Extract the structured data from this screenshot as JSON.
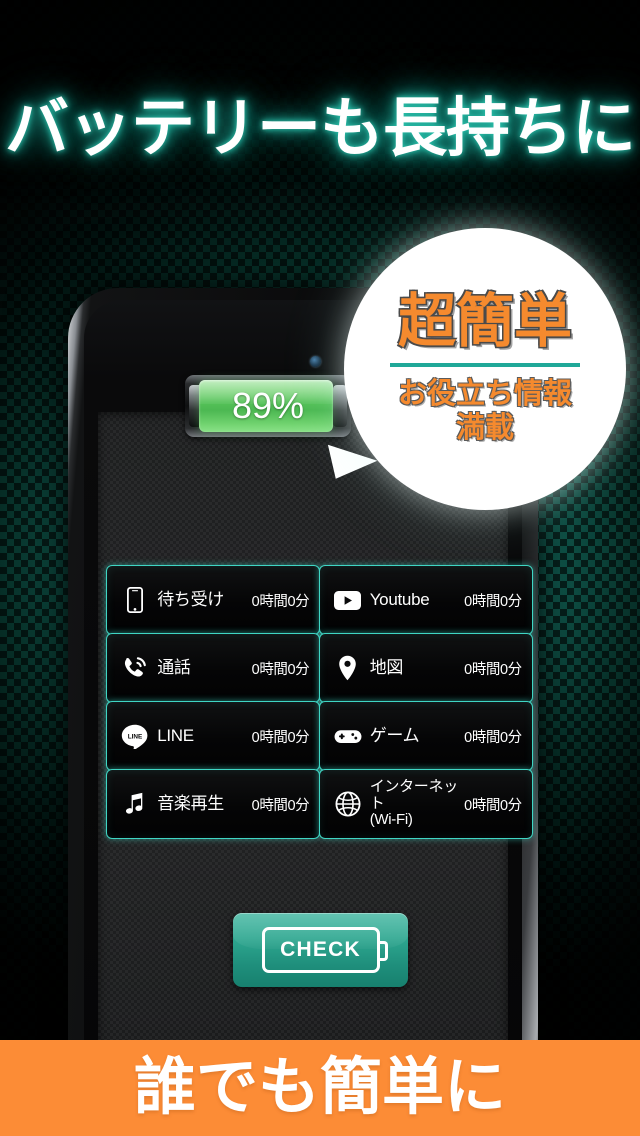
{
  "headline": {
    "text": "バッテリーも長持ちに",
    "glow_color": "#1fa898",
    "text_color": "#ffffff"
  },
  "badge": {
    "main_text": "超簡単",
    "sub_line1": "お役立ち情報",
    "sub_line2": "満載",
    "text_color": "#f58a2e",
    "rule_color": "#1fa898",
    "background_color": "#ffffff"
  },
  "battery": {
    "percent_label": "89%",
    "percent_value": 89,
    "fill_color": "#55c258"
  },
  "usage_grid": {
    "rows": [
      {
        "left": {
          "icon": "smartphone-icon",
          "label": "待ち受け",
          "time": "0時間0分"
        },
        "right": {
          "icon": "youtube-icon",
          "label": "Youtube",
          "time": "0時間0分"
        }
      },
      {
        "left": {
          "icon": "phone-call-icon",
          "label": "通話",
          "time": "0時間0分"
        },
        "right": {
          "icon": "map-pin-icon",
          "label": "地図",
          "time": "0時間0分"
        }
      },
      {
        "left": {
          "icon": "line-logo-icon",
          "label": "LINE",
          "time": "0時間0分"
        },
        "right": {
          "icon": "gamepad-icon",
          "label": "ゲーム",
          "time": "0時間0分"
        }
      },
      {
        "left": {
          "icon": "music-note-icon",
          "label": "音楽再生",
          "time": "0時間0分"
        },
        "right": {
          "icon": "globe-icon",
          "label": "インターネット\n(Wi-Fi)",
          "time": "0時間0分"
        }
      }
    ],
    "border_color": "#3fd6c4"
  },
  "check_button": {
    "label": "CHECK",
    "background_color": "#2da68f"
  },
  "bottom_banner": {
    "text": "誰でも簡単に",
    "background_color": "#fc8c36",
    "text_color": "#ffffff"
  }
}
